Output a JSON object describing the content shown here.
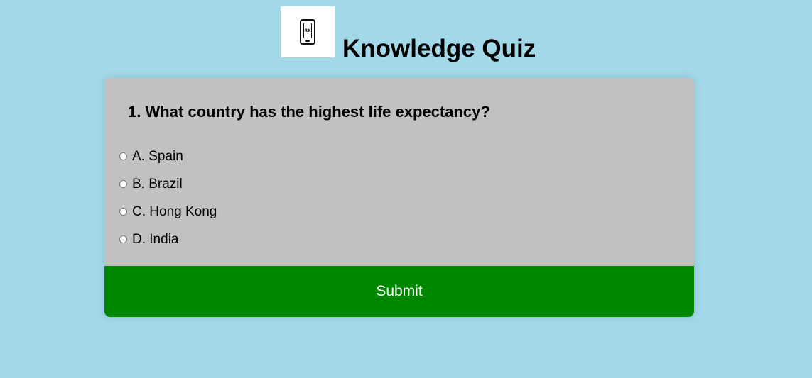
{
  "header": {
    "logo_icon": "phone-icon",
    "logo_text": "RK",
    "title": "Knowledge Quiz"
  },
  "quiz": {
    "question": "1. What country has the highest life expectancy?",
    "answers": [
      {
        "label": "A. Spain"
      },
      {
        "label": "B. Brazil"
      },
      {
        "label": "C. Hong Kong"
      },
      {
        "label": "D. India"
      }
    ],
    "submit_label": "Submit"
  },
  "colors": {
    "background": "#a2d8e8",
    "card": "#c1c1c1",
    "submit": "#008700"
  }
}
